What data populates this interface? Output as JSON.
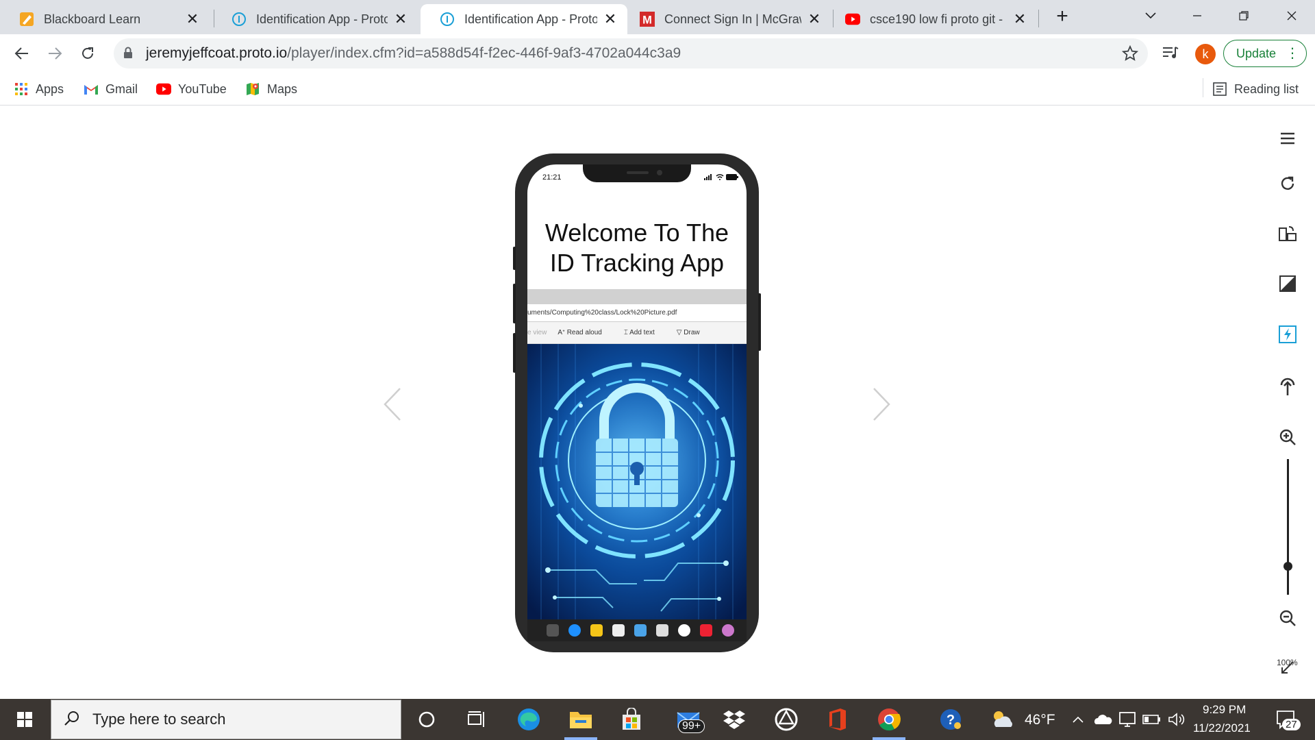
{
  "browser": {
    "tabs": [
      {
        "title": "Blackboard Learn",
        "icon": "blackboard-icon",
        "active": false
      },
      {
        "title": "Identification App - Proto",
        "icon": "proto-icon",
        "active": false
      },
      {
        "title": "Identification App - Proto",
        "icon": "proto-icon",
        "active": true
      },
      {
        "title": "Connect Sign In | McGraw",
        "icon": "mcgraw-icon",
        "active": false
      },
      {
        "title": "csce190 low fi proto git -",
        "icon": "youtube-icon",
        "active": false
      }
    ],
    "url_host": "jeremyjeffcoat.proto.io",
    "url_path": "/player/index.cfm?id=a588d54f-f2ec-446f-9af3-4702a044c3a9",
    "profile_initial": "k",
    "update_label": "Update",
    "bookmarks": [
      {
        "label": "Apps",
        "icon": "apps-grid-icon"
      },
      {
        "label": "Gmail",
        "icon": "gmail-icon"
      },
      {
        "label": "YouTube",
        "icon": "youtube-icon"
      },
      {
        "label": "Maps",
        "icon": "maps-icon"
      }
    ],
    "reading_list_label": "Reading list"
  },
  "phone": {
    "status_time": "21:21",
    "welcome_line1": "Welcome To The",
    "welcome_line2": "ID Tracking App",
    "pdf_url": "uments/Computing%20class/Lock%20Picture.pdf",
    "pdf_tools": [
      "e view",
      "Read aloud",
      "Add text",
      "Draw"
    ]
  },
  "player": {
    "zoom_label": "100%"
  },
  "taskbar": {
    "search_placeholder": "Type here to search",
    "mail_badge": "99+",
    "weather": "46°F",
    "time": "9:29 PM",
    "date": "11/22/2021",
    "notification_count": "27"
  },
  "colors": {
    "tab_strip": "#dee1e6",
    "update_green": "#188038",
    "avatar_orange": "#e8590c",
    "taskbar": "#3b3632"
  }
}
